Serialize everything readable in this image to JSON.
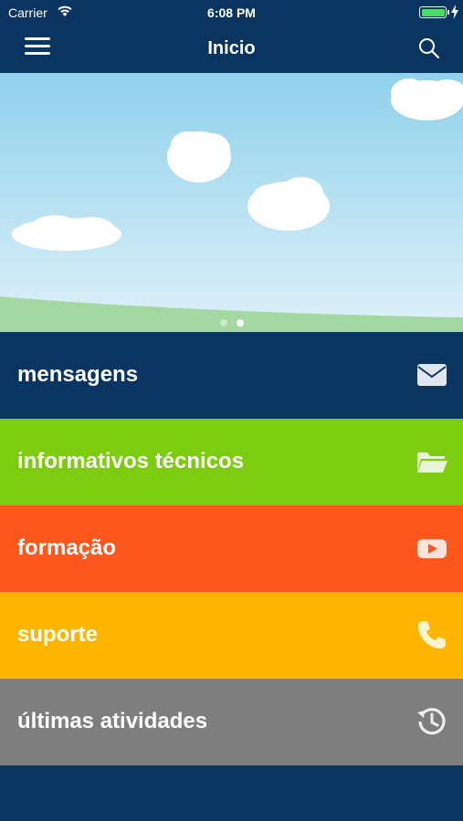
{
  "status_bar": {
    "carrier": "Carrier",
    "time": "6:08 PM",
    "battery_level": 1.0,
    "battery_color": "#4cd964"
  },
  "nav": {
    "title": "Inicio",
    "menu_icon": "hamburger-menu-icon",
    "search_icon": "search-icon",
    "background": "#0b3561"
  },
  "banner": {
    "page_count": 2,
    "active_page": 2,
    "sky_color": "#8fd1ec",
    "grass_color": "#a4d8a3"
  },
  "menu": {
    "items": [
      {
        "label": "mensagens",
        "icon": "envelope-icon",
        "color": "#0b3561"
      },
      {
        "label": "informativos técnicos",
        "icon": "open-folder-icon",
        "color": "#7ccd0f"
      },
      {
        "label": "formação",
        "icon": "video-play-icon",
        "color": "#fb561c"
      },
      {
        "label": "suporte",
        "icon": "phone-icon",
        "color": "#fdb500"
      },
      {
        "label": "últimas atividades",
        "icon": "history-icon",
        "color": "#7e7e7e"
      }
    ]
  }
}
